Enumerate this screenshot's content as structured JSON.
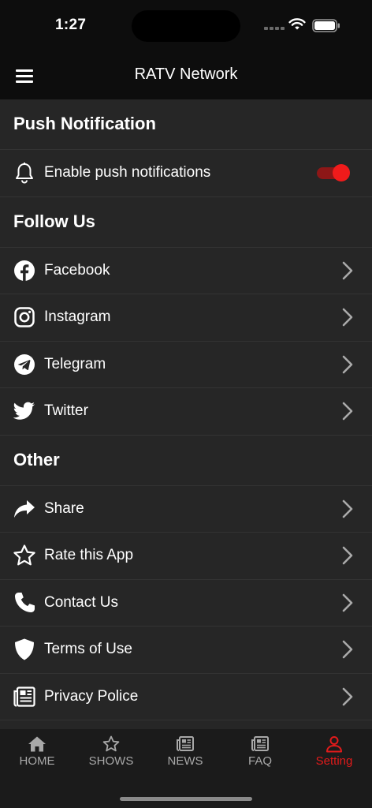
{
  "status": {
    "time": "1:27"
  },
  "header": {
    "title": "RATV Network"
  },
  "sections": {
    "push": {
      "title": "Push Notification",
      "enable_label": "Enable push notifications",
      "enabled": true
    },
    "follow": {
      "title": "Follow Us",
      "items": [
        {
          "label": "Facebook",
          "icon": "facebook-icon"
        },
        {
          "label": "Instagram",
          "icon": "instagram-icon"
        },
        {
          "label": "Telegram",
          "icon": "telegram-icon"
        },
        {
          "label": "Twitter",
          "icon": "twitter-icon"
        }
      ]
    },
    "other": {
      "title": "Other",
      "items": [
        {
          "label": "Share",
          "icon": "share-icon"
        },
        {
          "label": "Rate this App",
          "icon": "star-icon"
        },
        {
          "label": "Contact Us",
          "icon": "phone-icon"
        },
        {
          "label": "Terms of Use",
          "icon": "shield-icon"
        },
        {
          "label": "Privacy Police",
          "icon": "newspaper-icon"
        }
      ]
    }
  },
  "tabs": [
    {
      "label": "HOME",
      "icon": "home-icon"
    },
    {
      "label": "SHOWS",
      "icon": "star-icon"
    },
    {
      "label": "NEWS",
      "icon": "newspaper-icon"
    },
    {
      "label": "FAQ",
      "icon": "newspaper-icon"
    },
    {
      "label": "Setting",
      "icon": "person-icon",
      "active": true
    }
  ],
  "colors": {
    "accent": "#e21b1b",
    "background": "#262626",
    "header": "#0d0d0d",
    "tabbar": "#1b1b1b"
  }
}
